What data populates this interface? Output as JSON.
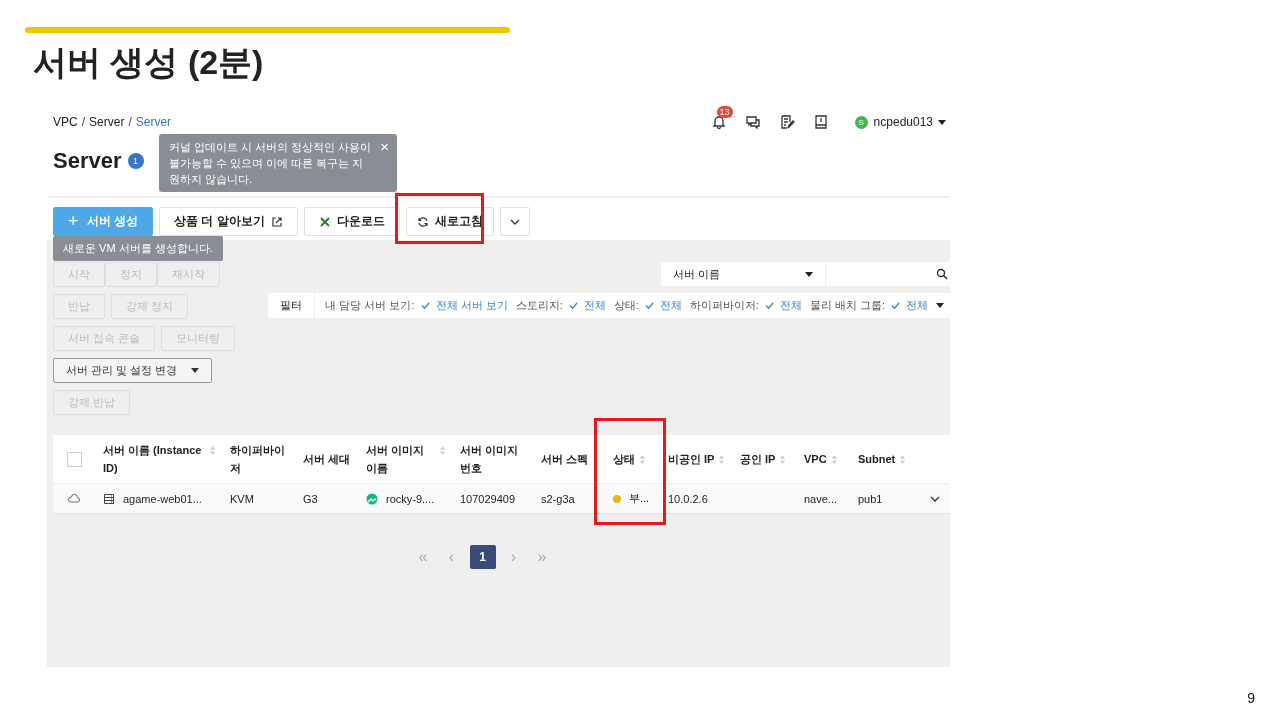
{
  "slide": {
    "title": "서버 생성 (2분)",
    "page_number": "9"
  },
  "console": {
    "breadcrumb": [
      {
        "label": "VPC",
        "kind": "link",
        "selected": false
      },
      {
        "label": "/",
        "kind": "separator"
      },
      {
        "label": "Server",
        "kind": "link",
        "selected": false
      },
      {
        "label": "/",
        "kind": "separator"
      },
      {
        "label": "Server",
        "kind": "link",
        "selected": true
      }
    ],
    "header": {
      "notification_count": "13",
      "user": "ncpedu013",
      "user_initial": "S"
    },
    "page_title": "Server",
    "info_badge": "1",
    "info_tooltip": "커널 업데이트 시 서버의 정상적인 사용이 불가능할 수 있으며 이에 따른 복구는 지원하지 않습니다.",
    "info_tooltip_close": "×",
    "toolbar": [
      {
        "label": "서버 생성",
        "kind": "primary",
        "icon": "+"
      },
      {
        "label": "상품 더 알아보기",
        "kind": "external"
      },
      {
        "label": "다운로드",
        "kind": "excel"
      },
      {
        "label": "새로고침",
        "kind": "refresh"
      },
      {
        "kind": "more"
      }
    ],
    "create_tooltip": "새로운 VM 서버를 생성합니다.",
    "action_rows": [
      [
        {
          "label": "시작",
          "disabled": true
        },
        {
          "label": "정지",
          "disabled": true
        },
        {
          "label": "재시작",
          "disabled": true
        }
      ],
      [
        {
          "label": "반납",
          "disabled": true
        },
        {
          "label": "강제 정지",
          "disabled": true
        }
      ],
      [
        {
          "label": "서버 접속 콘솔",
          "disabled": true
        },
        {
          "label": "모니터링",
          "disabled": true
        }
      ],
      [
        {
          "label": "서버 관리 및 설정 변경",
          "disabled": false,
          "kind": "dropdown"
        }
      ],
      [
        {
          "label": "강제 반납",
          "disabled": true
        }
      ]
    ],
    "search": {
      "field": "서버 이름"
    },
    "filter": {
      "label": "필터",
      "items": [
        {
          "label": "내 담당 서버 보기:",
          "value": "전체 서버 보기"
        },
        {
          "label": "스토리지:",
          "value": "전체"
        },
        {
          "label": "상태:",
          "value": "전체"
        },
        {
          "label": "하이퍼바이저:",
          "value": "전체"
        },
        {
          "label": "물리 배치 그룹:",
          "value": "전체"
        }
      ]
    },
    "table": {
      "all_checked": false,
      "columns": [
        {
          "label": "서버 이름 (Instance ID)",
          "sortable": true
        },
        {
          "label": "하이퍼바이저",
          "sortable": false
        },
        {
          "label": "서버 세대",
          "sortable": false
        },
        {
          "label": "서버 이미지 이름",
          "sortable": true
        },
        {
          "label": "서버 이미지 번호",
          "sortable": false
        },
        {
          "label": "서버 스펙",
          "sortable": false
        },
        {
          "label": "상태",
          "sortable": true
        },
        {
          "label": "비공인 IP",
          "sortable": true
        },
        {
          "label": "공인 IP",
          "sortable": true
        },
        {
          "label": "VPC",
          "sortable": true
        },
        {
          "label": "Subnet",
          "sortable": true
        }
      ],
      "rows": [
        {
          "checked": false,
          "cells": [
            "agame-web01...",
            "KVM",
            "G3",
            "rocky-9....",
            "107029409",
            "s2-g3a",
            "부...",
            "10.0.2.6",
            "",
            "nave...",
            "pub1"
          ],
          "status": {
            "color": "#e6b820"
          }
        }
      ]
    },
    "pagination": [
      {
        "label": "«",
        "disabled": true,
        "selected": false
      },
      {
        "label": "‹",
        "disabled": true,
        "selected": false
      },
      {
        "label": "1",
        "disabled": false,
        "selected": true
      },
      {
        "label": "›",
        "disabled": true,
        "selected": false
      },
      {
        "label": "»",
        "disabled": true,
        "selected": false
      }
    ]
  }
}
